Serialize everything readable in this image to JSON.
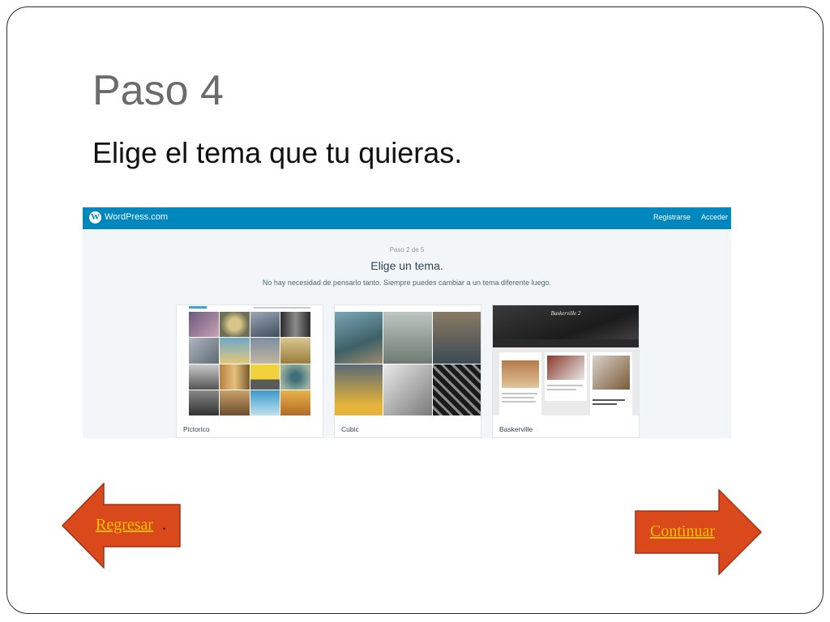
{
  "slide": {
    "title": "Paso 4",
    "subtitle": "Elige el tema que tu quieras."
  },
  "screenshot": {
    "brand": "WordPress.com",
    "nav": {
      "register": "Registrarse",
      "login": "Acceder"
    },
    "step": "Paso 2 de 5",
    "heading": "Elige un tema.",
    "description": "No hay necesidad de pensarlo tanto. Siempre puedes cambiar a un tema diferente luego.",
    "themes": [
      {
        "name": "Pictorico"
      },
      {
        "name": "Cubic"
      },
      {
        "name": "Baskerville"
      }
    ],
    "brand_color": "#0087be"
  },
  "navigation": {
    "back_label": "Regresar",
    "back_suffix": ".",
    "next_label": "Continuar",
    "arrow_color": "#d9491c",
    "link_color": "#f2c200"
  }
}
